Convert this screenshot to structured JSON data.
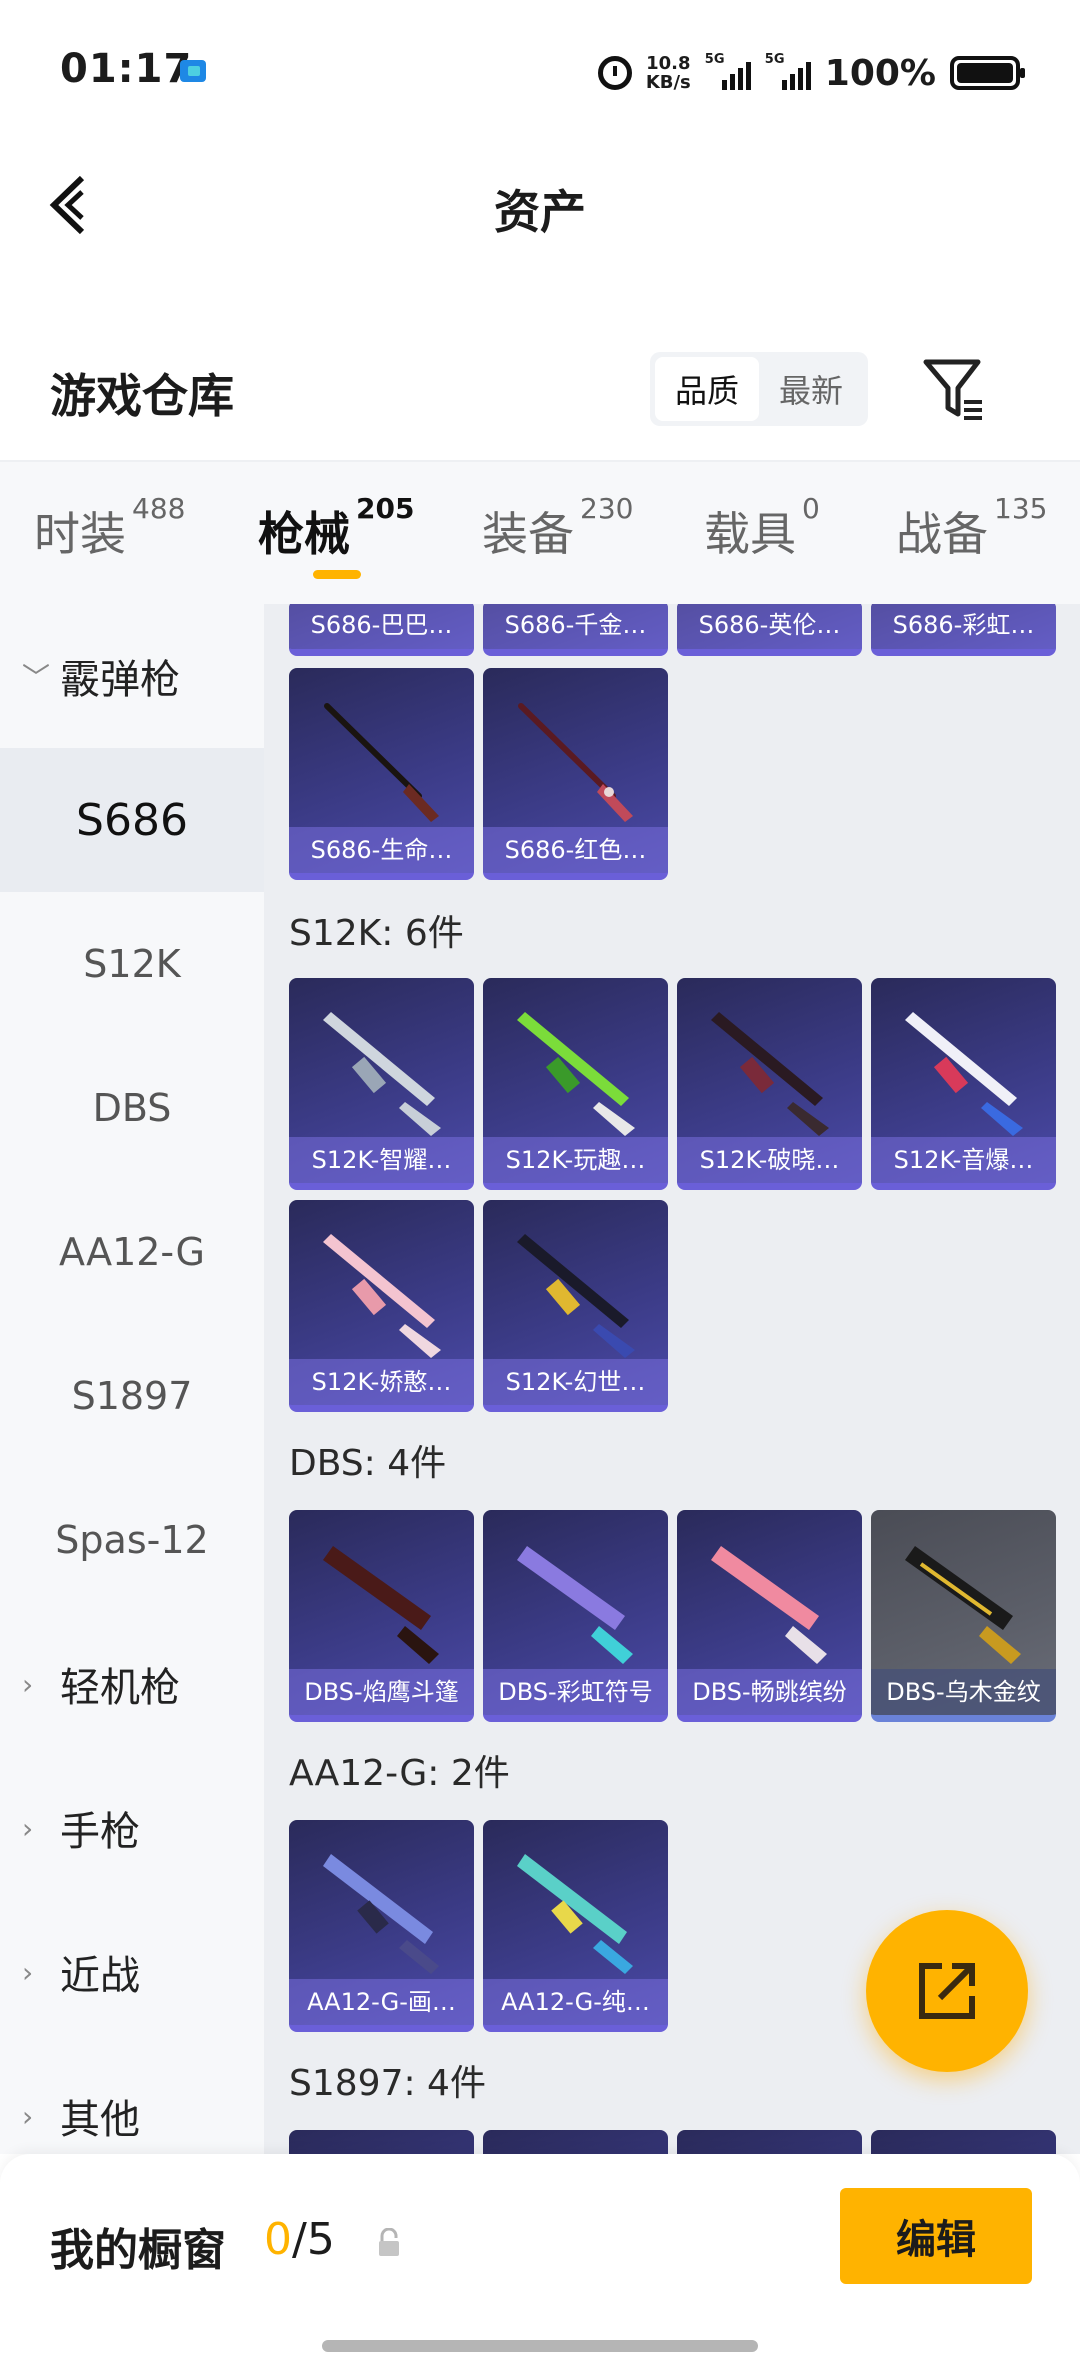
{
  "status_bar": {
    "time": "01:17",
    "net_speed_value": "10.8",
    "net_speed_unit": "KB/s",
    "signal1_label": "5G",
    "signal2_label": "5G",
    "battery": "100%"
  },
  "header": {
    "title": "资产"
  },
  "warehouse": {
    "title": "游戏仓库",
    "sort_options": [
      "品质",
      "最新"
    ],
    "sort_selected": "品质"
  },
  "tabs": [
    {
      "label": "时装",
      "count": "488"
    },
    {
      "label": "枪械",
      "count": "205",
      "active": true
    },
    {
      "label": "装备",
      "count": "230"
    },
    {
      "label": "载具",
      "count": "0"
    },
    {
      "label": "战备",
      "count": "135"
    }
  ],
  "sidebar": [
    {
      "label": "霰弹枪",
      "type": "group",
      "expanded": true
    },
    {
      "label": "S686",
      "type": "sub",
      "selected": true
    },
    {
      "label": "S12K",
      "type": "sub"
    },
    {
      "label": "DBS",
      "type": "sub"
    },
    {
      "label": "AA12-G",
      "type": "sub"
    },
    {
      "label": "S1897",
      "type": "sub"
    },
    {
      "label": "Spas-12",
      "type": "sub"
    },
    {
      "label": "轻机枪",
      "type": "group"
    },
    {
      "label": "手枪",
      "type": "group"
    },
    {
      "label": "近战",
      "type": "group"
    },
    {
      "label": "其他",
      "type": "group"
    }
  ],
  "sections": {
    "s686_top_row": [
      "S686-巴巴…",
      "S686-千金…",
      "S686-英伦…",
      "S686-彩虹…"
    ],
    "s686_items": [
      "S686-生命…",
      "S686-红色…"
    ],
    "s12k_title": "S12K: 6件",
    "s12k_items": [
      "S12K-智耀…",
      "S12K-玩趣…",
      "S12K-破晓…",
      "S12K-音爆…",
      "S12K-娇憨…",
      "S12K-幻世…"
    ],
    "dbs_title": "DBS: 4件",
    "dbs_items": [
      "DBS-焰鹰斗篷",
      "DBS-彩虹符号",
      "DBS-畅跳缤纷",
      "DBS-乌木金纹"
    ],
    "aa12_title": "AA12-G: 2件",
    "aa12_items": [
      "AA12-G-画…",
      "AA12-G-纯…"
    ],
    "s1897_title": "S1897: 4件"
  },
  "icons": {
    "back": "chevron-left-icon",
    "filter": "filter-icon",
    "share": "share-icon",
    "lock": "lock-icon"
  },
  "colors": {
    "accent": "#ffb300",
    "card_purple": "#3b3b86",
    "card_label": "#6a5fd8"
  },
  "bottom_bar": {
    "showcase_label": "我的橱窗",
    "showcase_current": "0",
    "showcase_total": "/5",
    "edit_label": "编辑"
  }
}
